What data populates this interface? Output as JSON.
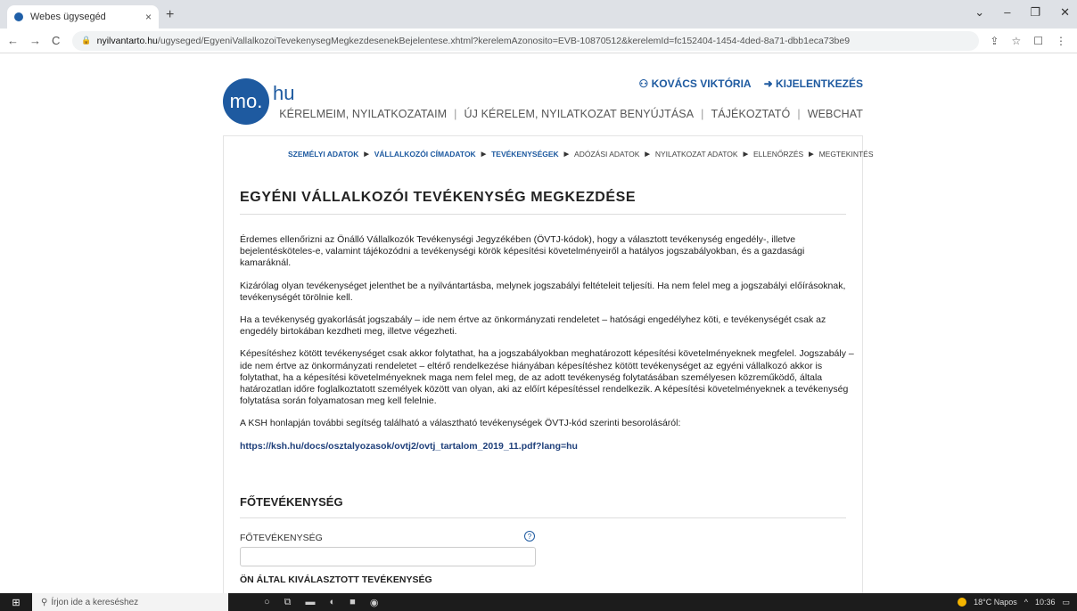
{
  "browser": {
    "tab_title": "Webes ügysegéd",
    "tab_close": "×",
    "new_tab": "+",
    "url_host": "nyilvantarto.hu",
    "url_path": "/ugyseged/EgyeniVallalkozoiTevekenysegMegkezdesenekBejelentese.xhtml?kerelemAzonosito=EVB-10870512&kerelemId=fc152404-1454-4ded-8a71-dbb1eca73be9",
    "nav_back": "←",
    "nav_forward": "→",
    "nav_reload": "C",
    "win_min": "–",
    "win_max": "❐",
    "win_close": "✕",
    "win_collapse": "⌄",
    "action_share": "⇪",
    "action_star": "☆",
    "action_side": "☐",
    "action_menu": "⋮"
  },
  "header": {
    "logo_circle": "mo.",
    "logo_suffix": "hu",
    "user_name": "KOVÁCS VIKTÓRIA",
    "logout": "KIJELENTKEZÉS",
    "nav_items": [
      "KÉRELMEIM, NYILATKOZATAIM",
      "ÚJ KÉRELEM, NYILATKOZAT BENYÚJTÁSA",
      "TÁJÉKOZTATÓ",
      "WEBCHAT"
    ]
  },
  "steps": {
    "s1": "SZEMÉLYI ADATOK",
    "s2": "VÁLLALKOZÓI CÍMADATOK",
    "s3": "TEVÉKENYSÉGEK",
    "s4": "ADÓZÁSI ADATOK",
    "s5": "NYILATKOZAT ADATOK",
    "s6": "ELLENŐRZÉS",
    "s7": "MEGTEKINTÉS"
  },
  "main": {
    "title": "EGYÉNI VÁLLALKOZÓI TEVÉKENYSÉG MEGKEZDÉSE",
    "p1": "Érdemes ellenőrizni az Önálló Vállalkozók Tevékenységi Jegyzékében (ÖVTJ-kódok), hogy a választott tevékenység engedély-, illetve bejelentésköteles-e, valamint tájékozódni a tevékenységi körök képesítési követelményeiről a hatályos jogszabályokban, és a gazdasági kamaráknál.",
    "p2": "Kizárólag olyan tevékenységet jelenthet be a nyilvántartásba, melynek jogszabályi feltételeit teljesíti. Ha nem felel meg a jogszabályi előírásoknak, tevékenységét törölnie kell.",
    "p3": "Ha a tevékenység gyakorlását jogszabály – ide nem értve az önkormányzati rendeletet – hatósági engedélyhez köti, e tevékenységét csak az engedély birtokában kezdheti meg, illetve végezheti.",
    "p4": "Képesítéshez kötött tevékenységet csak akkor folytathat, ha a jogszabályokban meghatározott képesítési követelményeknek megfelel. Jogszabály – ide nem értve az önkormányzati rendeletet – eltérő rendelkezése hiányában képesítéshez kötött tevékenységet az egyéni vállalkozó akkor is folytathat, ha a képesítési követelményeknek maga nem felel meg, de az adott tevékenység folytatásában személyesen közreműködő, általa határozatlan időre foglalkoztatott személyek között van olyan, aki az előírt képesítéssel rendelkezik. A képesítési követelményeknek a tevékenység folytatása során folyamatosan meg kell felelnie.",
    "p5": "A KSH honlapján további segítség található a választható tevékenységek ÖVTJ-kód szerinti besorolásáról:",
    "link": "https://ksh.hu/docs/osztalyozasok/ovtj2/ovtj_tartalom_2019_11.pdf?lang=hu",
    "section_title": "FŐTEVÉKENYSÉG",
    "field_label": "FŐTEVÉKENYSÉG",
    "field_value": "",
    "help": "?",
    "selected_label": "ÖN ÁLTAL KIVÁLASZTOTT TEVÉKENYSÉG"
  },
  "taskbar": {
    "start": "⊞",
    "search_placeholder": "Írjon ide a kereséshez",
    "weather": "18°C Napos",
    "time": "10:36"
  }
}
